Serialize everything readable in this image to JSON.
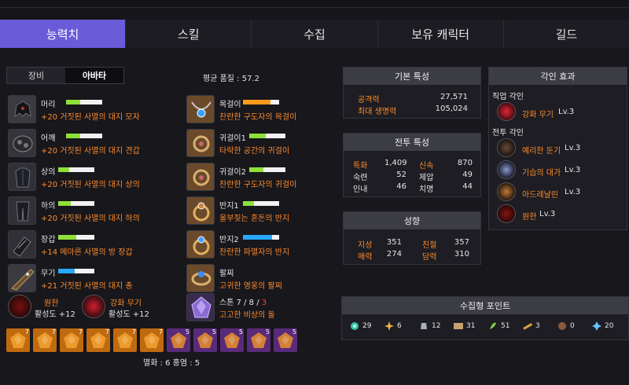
{
  "tabs": [
    "능력치",
    "스킬",
    "수집",
    "보유 캐릭터",
    "길드"
  ],
  "subtabs": [
    "장비",
    "아바타"
  ],
  "avg_quality": "평균 품질 : 57.2",
  "equipment_left": [
    {
      "name": "머리",
      "desc": "+20 거짓된 사멸의 대지 모자",
      "bar": 0.4,
      "bar_color": "#8fe03a"
    },
    {
      "name": "어깨",
      "desc": "+20 거짓된 사멸의 대지 견갑",
      "bar": 0.4,
      "bar_color": "#8fe03a"
    },
    {
      "name": "상의",
      "desc": "+20 거짓된 사멸의 대지 상의",
      "bar": 0.3,
      "bar_color": "#8fe03a"
    },
    {
      "name": "하의",
      "desc": "+20 거짓된 사멸의 대지 하의",
      "bar": 0.35,
      "bar_color": "#8fe03a"
    },
    {
      "name": "장갑",
      "desc": "+14 메마른 사멸의 방 장갑",
      "bar": 0.5,
      "bar_color": "#8fe03a"
    },
    {
      "name": "무기",
      "desc": "+21 거짓된 사멸의 대지 총",
      "bar": 0.45,
      "bar_color": "#28a8ff"
    }
  ],
  "equipment_right": [
    {
      "name": "목걸이",
      "desc": "찬란한 구도자의 목걸이",
      "bar": 0.75,
      "bar_color": "#ff9a1a"
    },
    {
      "name": "귀걸이1",
      "desc": "타락한 공간의 귀걸이",
      "bar": 0.45,
      "bar_color": "#8fe03a"
    },
    {
      "name": "귀걸이2",
      "desc": "찬란한 구도자의 귀걸이",
      "bar": 0.4,
      "bar_color": "#8fe03a"
    },
    {
      "name": "반지1",
      "desc": "울부짖는 혼돈의 반지",
      "bar": 0.3,
      "bar_color": "#8fe03a"
    },
    {
      "name": "반지2",
      "desc": "찬란한 파멸자의 반지",
      "bar": 0.8,
      "bar_color": "#28a8ff"
    },
    {
      "name": "팔찌",
      "desc": "고귀한 영웅의 팔찌",
      "bar": null,
      "bar_color": null
    }
  ],
  "stone": {
    "label": "스톤 7 / 8 / ",
    "red": "3",
    "desc": "고고한 비상의 돌"
  },
  "engravings_equipped": [
    {
      "name": "원한",
      "activity": "활성도 +12"
    },
    {
      "name": "강화 무기",
      "activity": "활성도 +12"
    }
  ],
  "gems": [
    {
      "lv": "7",
      "type": "멸화"
    },
    {
      "lv": "7",
      "type": "멸화"
    },
    {
      "lv": "7",
      "type": "멸화"
    },
    {
      "lv": "7",
      "type": "멸화"
    },
    {
      "lv": "7",
      "type": "멸화"
    },
    {
      "lv": "7",
      "type": "멸화"
    },
    {
      "lv": "5",
      "type": "홍염"
    },
    {
      "lv": "5",
      "type": "홍염"
    },
    {
      "lv": "5",
      "type": "홍염"
    },
    {
      "lv": "5",
      "type": "홍염"
    },
    {
      "lv": "5",
      "type": "홍염"
    }
  ],
  "gem_summary": "멸화 : 6  홍염 : 5",
  "basic_stats": {
    "title": "기본 특성",
    "rows": [
      {
        "label": "공격력",
        "value": "27,571"
      },
      {
        "label": "최대 생명력",
        "value": "105,024"
      }
    ]
  },
  "combat_stats": {
    "title": "전투 특성",
    "rows": [
      {
        "l1": "특화",
        "v1": "1,409",
        "l2": "신속",
        "v2": "870"
      },
      {
        "l1": "숙련",
        "v1": "52",
        "l2": "제압",
        "v2": "49"
      },
      {
        "l1": "인내",
        "v1": "46",
        "l2": "치명",
        "v2": "44"
      }
    ]
  },
  "tendency": {
    "title": "성향",
    "rows": [
      {
        "l1": "지성",
        "v1": "351",
        "l2": "친절",
        "v2": "357"
      },
      {
        "l1": "매력",
        "v1": "274",
        "l2": "담력",
        "v2": "310"
      }
    ]
  },
  "engrave_effects": {
    "title": "각인 효과",
    "job_title": "직업 각인",
    "job": [
      {
        "name": "강화 무기",
        "lv": "Lv.3"
      }
    ],
    "combat_title": "전투 각인",
    "combat": [
      {
        "name": "예리한 둔기",
        "lv": "Lv.3"
      },
      {
        "name": "기습의 대가",
        "lv": "Lv.3"
      },
      {
        "name": "아드레날린",
        "lv": "Lv.3"
      },
      {
        "name": "원한",
        "lv": "Lv.3"
      }
    ]
  },
  "collect": {
    "title": "수집형 포인트",
    "items": [
      {
        "icon": "island-heart-icon",
        "value": "29"
      },
      {
        "icon": "orpheus-star-icon",
        "value": "6"
      },
      {
        "icon": "giant-heart-icon",
        "value": "12"
      },
      {
        "icon": "artwork-icon",
        "value": "31"
      },
      {
        "icon": "mokoko-seed-icon",
        "value": "51"
      },
      {
        "icon": "sea-bounty-icon",
        "value": "3"
      },
      {
        "icon": "world-tree-leaf-icon",
        "value": "0"
      },
      {
        "icon": "ignea-token-icon",
        "value": "20"
      }
    ]
  }
}
